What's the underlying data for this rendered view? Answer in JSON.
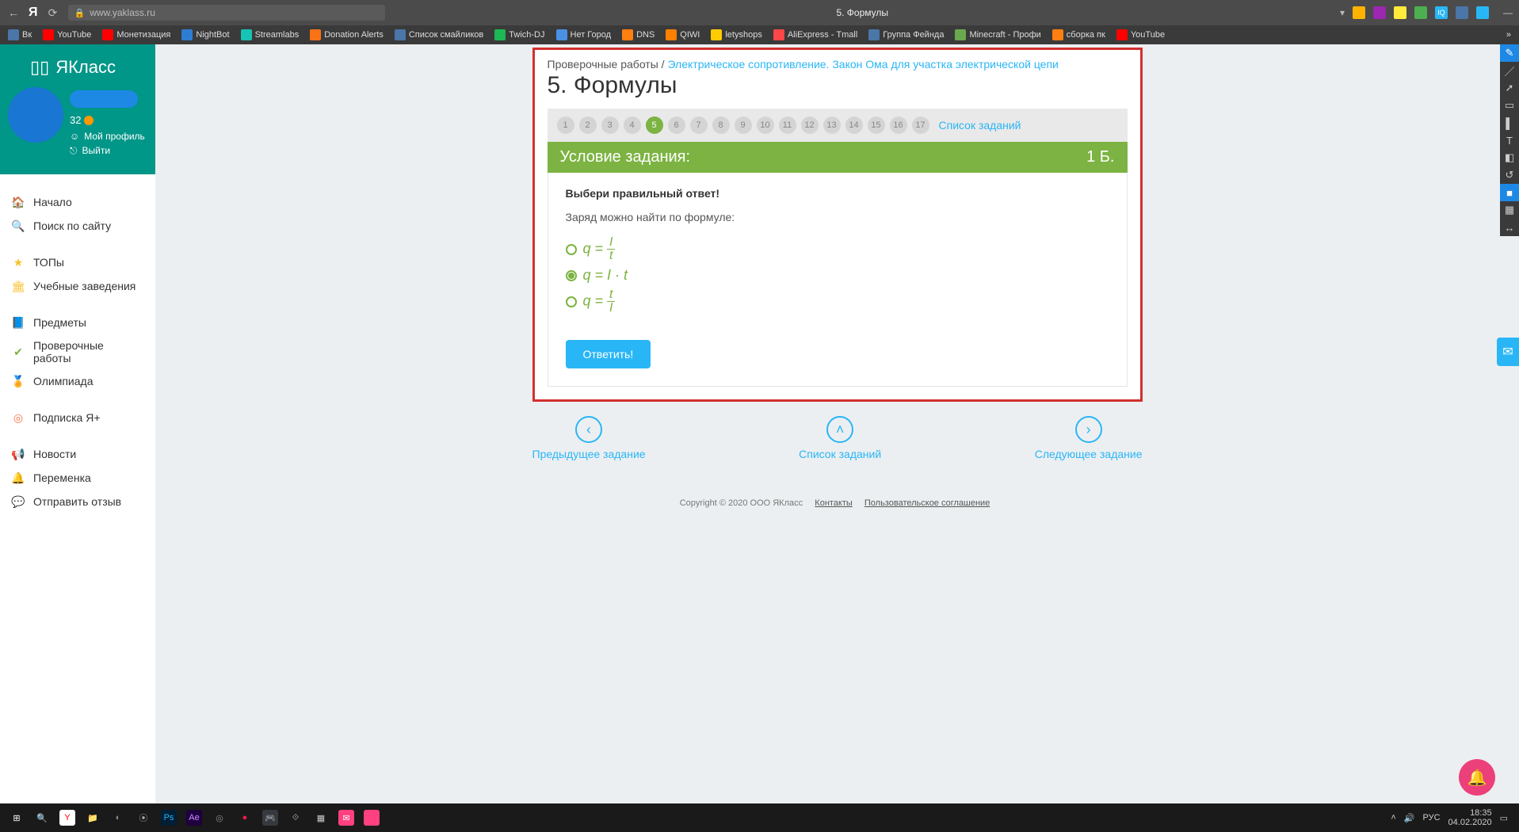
{
  "browser": {
    "url": "www.yaklass.ru",
    "tab_title": "5. Формулы"
  },
  "bookmarks": [
    {
      "label": "Вк",
      "color": "#4a76a8"
    },
    {
      "label": "YouTube",
      "color": "#ff0000"
    },
    {
      "label": "Монетизация",
      "color": "#ff0000"
    },
    {
      "label": "NightBot",
      "color": "#2d7dd2"
    },
    {
      "label": "Streamlabs",
      "color": "#17c3b2"
    },
    {
      "label": "Donation Alerts",
      "color": "#f97316"
    },
    {
      "label": "Список смайликов",
      "color": "#4a76a8"
    },
    {
      "label": "Twich-DJ",
      "color": "#1db954"
    },
    {
      "label": "Нет Город",
      "color": "#4a90e2"
    },
    {
      "label": "DNS",
      "color": "#ff7f11"
    },
    {
      "label": "QIWI",
      "color": "#ff8000"
    },
    {
      "label": "letyshops",
      "color": "#ffcc00"
    },
    {
      "label": "AliExpress - Tmall",
      "color": "#ff4747"
    },
    {
      "label": "Группа Фейнда",
      "color": "#4a76a8"
    },
    {
      "label": "Minecraft - Профи",
      "color": "#6aa84f"
    },
    {
      "label": "сборка пк",
      "color": "#ff7f11"
    },
    {
      "label": "YouTube",
      "color": "#ff0000"
    }
  ],
  "sidebar": {
    "logo": "ЯКласс",
    "score": "32",
    "profile": "Мой профиль",
    "logout": "Выйти",
    "groups": [
      [
        {
          "icon": "🏠",
          "color": "#29b6f6",
          "label": "Начало"
        },
        {
          "icon": "🔍",
          "color": "#29b6f6",
          "label": "Поиск по сайту"
        }
      ],
      [
        {
          "icon": "★",
          "color": "#fbc02d",
          "label": "ТОПы"
        },
        {
          "icon": "🏛",
          "color": "#fbc02d",
          "label": "Учебные заведения"
        }
      ],
      [
        {
          "icon": "📘",
          "color": "#ef5350",
          "label": "Предметы"
        },
        {
          "icon": "✔",
          "color": "#7cb342",
          "label": "Проверочные работы"
        },
        {
          "icon": "🏅",
          "color": "#7cb342",
          "label": "Олимпиада"
        }
      ],
      [
        {
          "icon": "◎",
          "color": "#ff7043",
          "label": "Подписка Я+"
        }
      ],
      [
        {
          "icon": "📢",
          "color": "#607d8b",
          "label": "Новости"
        },
        {
          "icon": "🔔",
          "color": "#607d8b",
          "label": "Переменка"
        },
        {
          "icon": "💬",
          "color": "#607d8b",
          "label": "Отправить отзыв"
        }
      ]
    ]
  },
  "breadcrumb": {
    "root": "Проверочные работы",
    "topic": "Электрическое сопротивление. Закон Ома для участка электрической цепи"
  },
  "title": "5. Формулы",
  "tasks": {
    "count": 17,
    "active": 5,
    "list_label": "Список заданий"
  },
  "greenbar": {
    "label": "Условие задания:",
    "points": "1 Б."
  },
  "question": {
    "prompt": "Выбери правильный ответ!",
    "text": "Заряд можно найти по формуле:",
    "options": [
      {
        "display": "q = I / t",
        "selected": false,
        "frac_num": "I",
        "frac_den": "t"
      },
      {
        "display": "q = I · t",
        "selected": true,
        "inline": "q = I · t"
      },
      {
        "display": "q = t / I",
        "selected": false,
        "frac_num": "t",
        "frac_den": "I"
      }
    ],
    "submit": "Ответить!"
  },
  "bottom_nav": {
    "prev": "Предыдущее задание",
    "list": "Список заданий",
    "next": "Следующее задание"
  },
  "footer": {
    "copyright": "Copyright © 2020 ООО ЯКласс",
    "contacts": "Контакты",
    "terms": "Пользовательское соглашение"
  },
  "taskbar": {
    "apps": [
      {
        "glyph": "⊞",
        "color": "#fff"
      },
      {
        "glyph": "🔍",
        "color": "#fff"
      },
      {
        "glyph": "Y",
        "color": "#ff0000",
        "bg": "#fff"
      },
      {
        "glyph": "📁",
        "color": "#ffcc00"
      },
      {
        "glyph": "◐",
        "color": "#888"
      },
      {
        "glyph": "⦿",
        "color": "#aaa"
      },
      {
        "glyph": "Ps",
        "color": "#29b6f6",
        "bg": "#001e36"
      },
      {
        "glyph": "Ae",
        "color": "#cf8dff",
        "bg": "#1f003f"
      },
      {
        "glyph": "◎",
        "color": "#888"
      },
      {
        "glyph": "●",
        "color": "#ff1744"
      },
      {
        "glyph": "🎮",
        "color": "#7289da",
        "bg": "#36393f"
      },
      {
        "glyph": "⟐",
        "color": "#aaa"
      },
      {
        "glyph": "▦",
        "color": "#ccc"
      },
      {
        "glyph": "✉",
        "color": "#fff",
        "bg": "#ff4081"
      },
      {
        "glyph": " ",
        "bg": "#ff4081"
      }
    ],
    "lang": "РУС",
    "time": "18:35",
    "date": "04.02.2020"
  }
}
